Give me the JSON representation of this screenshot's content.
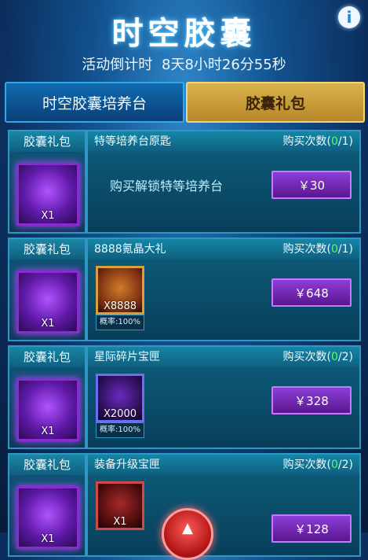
{
  "header": {
    "title": "时空胶囊",
    "info_icon": "i",
    "countdown_label": "活动倒计时",
    "countdown_value": "8天8小时26分55秒"
  },
  "tabs": [
    {
      "label": "时空胶囊培养台",
      "active": false
    },
    {
      "label": "胶囊礼包",
      "active": true
    }
  ],
  "rows": [
    {
      "left_title": "胶囊礼包",
      "left_qty": "X1",
      "title": "特等培养台原匙",
      "buy_label": "购买次数(",
      "buy_current": "0",
      "buy_total": "/1)",
      "desc": "购买解锁特等培养台",
      "price": "￥30"
    },
    {
      "left_title": "胶囊礼包",
      "left_qty": "X1",
      "title": "8888氪晶大礼",
      "buy_label": "购买次数(",
      "buy_current": "0",
      "buy_total": "/1)",
      "reward_qty": "X8888",
      "prob": "概率:100%",
      "price": "￥648"
    },
    {
      "left_title": "胶囊礼包",
      "left_qty": "X1",
      "title": "星际碎片宝匣",
      "buy_label": "购买次数(",
      "buy_current": "0",
      "buy_total": "/2)",
      "reward_qty": "X2000",
      "prob": "概率:100%",
      "price": "￥328"
    },
    {
      "left_title": "胶囊礼包",
      "left_qty": "X1",
      "title": "装备升级宝匣",
      "buy_label": "购买次数(",
      "buy_current": "0",
      "buy_total": "/2)",
      "reward_qty": "X1",
      "price": "￥128"
    }
  ],
  "icons": {
    "info": "info-icon",
    "fab": "chevron-up-icon"
  },
  "colors": {
    "accent_gold": "#d8b34b",
    "accent_blue": "#0f6cb0",
    "highlight_green": "#58ff58",
    "price_purple": "#8d3ed8"
  }
}
